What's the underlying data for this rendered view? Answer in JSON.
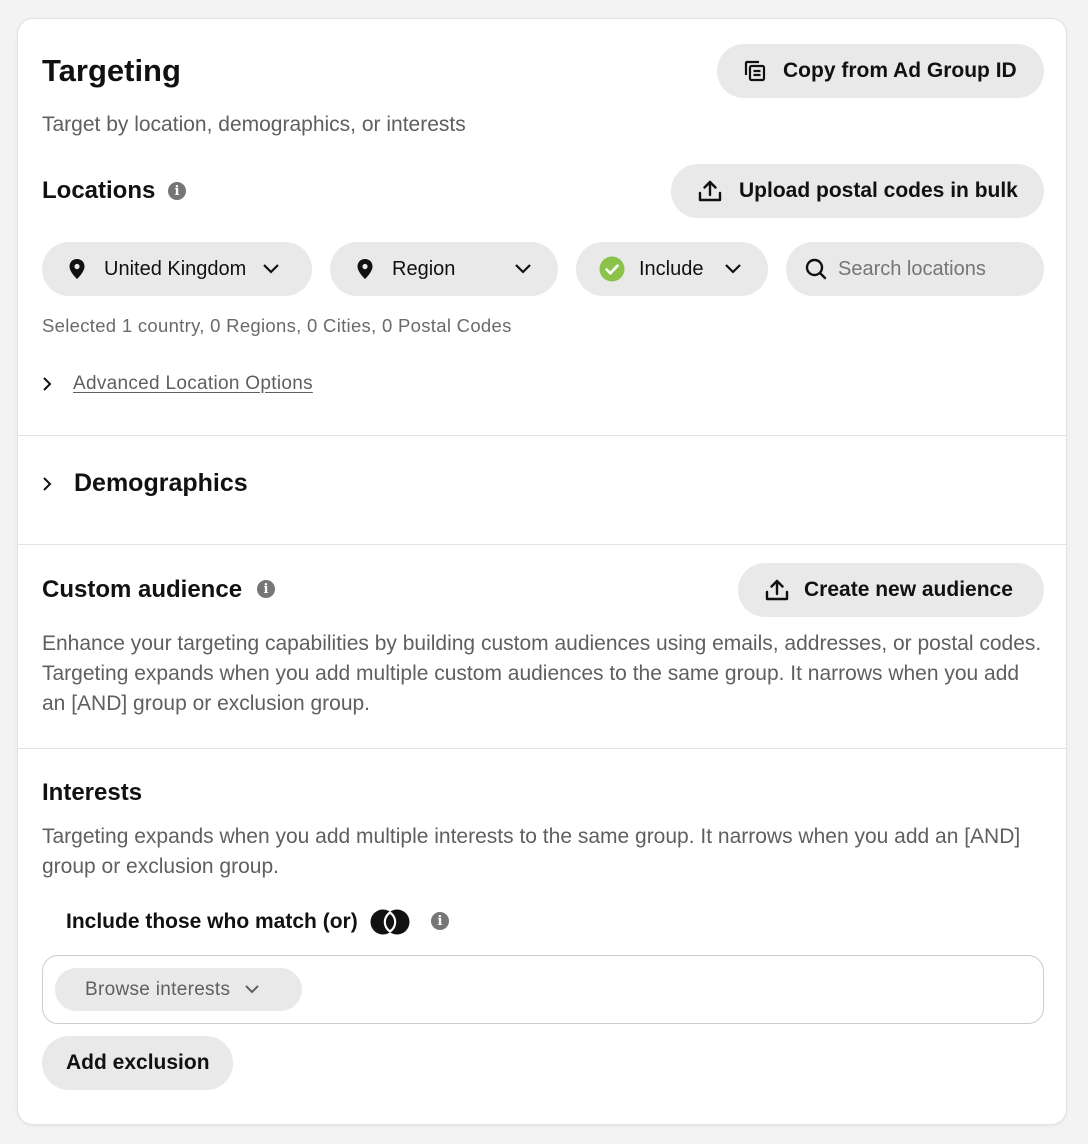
{
  "header": {
    "title": "Targeting",
    "subtitle": "Target by location, demographics, or interests",
    "copy_button": "Copy from Ad Group ID"
  },
  "locations": {
    "title": "Locations",
    "upload_button": "Upload postal codes in bulk",
    "country_dropdown": "United Kingdom",
    "region_dropdown": "Region",
    "include_dropdown": "Include",
    "search_placeholder": "Search locations",
    "summary": "Selected 1 country, 0 Regions, 0 Cities, 0 Postal Codes",
    "advanced_link": "Advanced Location Options"
  },
  "demographics": {
    "title": "Demographics"
  },
  "custom_audience": {
    "title": "Custom audience",
    "create_button": "Create new audience",
    "description": "Enhance your targeting capabilities by building custom audiences using emails, addresses, or postal codes. Targeting expands when you add multiple custom audiences to the same group. It narrows when you add an [AND] group or exclusion group."
  },
  "interests": {
    "title": "Interests",
    "description": "Targeting expands when you add multiple interests to the same group. It narrows when you add an [AND] group or exclusion group.",
    "match_label": "Include those who match (or)",
    "browse_button": "Browse interests",
    "add_exclusion_button": "Add exclusion"
  },
  "icons": {
    "copy": "copy-icon",
    "upload": "upload-icon",
    "location_pin": "location-pin-icon",
    "chevron_down": "chevron-down-icon",
    "chevron_right": "chevron-right-icon",
    "check_circle": "check-circle-icon",
    "search": "search-icon",
    "info": "info-icon",
    "or_toggle": "or-group-icon"
  },
  "colors": {
    "pill_bg": "#e9e9e9",
    "success_green": "#8bc34a",
    "muted_text": "#5f5f5f"
  }
}
